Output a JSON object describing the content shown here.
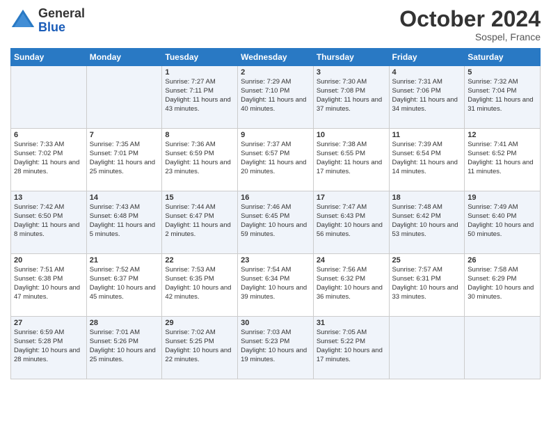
{
  "header": {
    "logo_general": "General",
    "logo_blue": "Blue",
    "month_title": "October 2024",
    "location": "Sospel, France"
  },
  "weekdays": [
    "Sunday",
    "Monday",
    "Tuesday",
    "Wednesday",
    "Thursday",
    "Friday",
    "Saturday"
  ],
  "weeks": [
    [
      {
        "day": "",
        "info": ""
      },
      {
        "day": "",
        "info": ""
      },
      {
        "day": "1",
        "info": "Sunrise: 7:27 AM\nSunset: 7:11 PM\nDaylight: 11 hours and 43 minutes."
      },
      {
        "day": "2",
        "info": "Sunrise: 7:29 AM\nSunset: 7:10 PM\nDaylight: 11 hours and 40 minutes."
      },
      {
        "day": "3",
        "info": "Sunrise: 7:30 AM\nSunset: 7:08 PM\nDaylight: 11 hours and 37 minutes."
      },
      {
        "day": "4",
        "info": "Sunrise: 7:31 AM\nSunset: 7:06 PM\nDaylight: 11 hours and 34 minutes."
      },
      {
        "day": "5",
        "info": "Sunrise: 7:32 AM\nSunset: 7:04 PM\nDaylight: 11 hours and 31 minutes."
      }
    ],
    [
      {
        "day": "6",
        "info": "Sunrise: 7:33 AM\nSunset: 7:02 PM\nDaylight: 11 hours and 28 minutes."
      },
      {
        "day": "7",
        "info": "Sunrise: 7:35 AM\nSunset: 7:01 PM\nDaylight: 11 hours and 25 minutes."
      },
      {
        "day": "8",
        "info": "Sunrise: 7:36 AM\nSunset: 6:59 PM\nDaylight: 11 hours and 23 minutes."
      },
      {
        "day": "9",
        "info": "Sunrise: 7:37 AM\nSunset: 6:57 PM\nDaylight: 11 hours and 20 minutes."
      },
      {
        "day": "10",
        "info": "Sunrise: 7:38 AM\nSunset: 6:55 PM\nDaylight: 11 hours and 17 minutes."
      },
      {
        "day": "11",
        "info": "Sunrise: 7:39 AM\nSunset: 6:54 PM\nDaylight: 11 hours and 14 minutes."
      },
      {
        "day": "12",
        "info": "Sunrise: 7:41 AM\nSunset: 6:52 PM\nDaylight: 11 hours and 11 minutes."
      }
    ],
    [
      {
        "day": "13",
        "info": "Sunrise: 7:42 AM\nSunset: 6:50 PM\nDaylight: 11 hours and 8 minutes."
      },
      {
        "day": "14",
        "info": "Sunrise: 7:43 AM\nSunset: 6:48 PM\nDaylight: 11 hours and 5 minutes."
      },
      {
        "day": "15",
        "info": "Sunrise: 7:44 AM\nSunset: 6:47 PM\nDaylight: 11 hours and 2 minutes."
      },
      {
        "day": "16",
        "info": "Sunrise: 7:46 AM\nSunset: 6:45 PM\nDaylight: 10 hours and 59 minutes."
      },
      {
        "day": "17",
        "info": "Sunrise: 7:47 AM\nSunset: 6:43 PM\nDaylight: 10 hours and 56 minutes."
      },
      {
        "day": "18",
        "info": "Sunrise: 7:48 AM\nSunset: 6:42 PM\nDaylight: 10 hours and 53 minutes."
      },
      {
        "day": "19",
        "info": "Sunrise: 7:49 AM\nSunset: 6:40 PM\nDaylight: 10 hours and 50 minutes."
      }
    ],
    [
      {
        "day": "20",
        "info": "Sunrise: 7:51 AM\nSunset: 6:38 PM\nDaylight: 10 hours and 47 minutes."
      },
      {
        "day": "21",
        "info": "Sunrise: 7:52 AM\nSunset: 6:37 PM\nDaylight: 10 hours and 45 minutes."
      },
      {
        "day": "22",
        "info": "Sunrise: 7:53 AM\nSunset: 6:35 PM\nDaylight: 10 hours and 42 minutes."
      },
      {
        "day": "23",
        "info": "Sunrise: 7:54 AM\nSunset: 6:34 PM\nDaylight: 10 hours and 39 minutes."
      },
      {
        "day": "24",
        "info": "Sunrise: 7:56 AM\nSunset: 6:32 PM\nDaylight: 10 hours and 36 minutes."
      },
      {
        "day": "25",
        "info": "Sunrise: 7:57 AM\nSunset: 6:31 PM\nDaylight: 10 hours and 33 minutes."
      },
      {
        "day": "26",
        "info": "Sunrise: 7:58 AM\nSunset: 6:29 PM\nDaylight: 10 hours and 30 minutes."
      }
    ],
    [
      {
        "day": "27",
        "info": "Sunrise: 6:59 AM\nSunset: 5:28 PM\nDaylight: 10 hours and 28 minutes."
      },
      {
        "day": "28",
        "info": "Sunrise: 7:01 AM\nSunset: 5:26 PM\nDaylight: 10 hours and 25 minutes."
      },
      {
        "day": "29",
        "info": "Sunrise: 7:02 AM\nSunset: 5:25 PM\nDaylight: 10 hours and 22 minutes."
      },
      {
        "day": "30",
        "info": "Sunrise: 7:03 AM\nSunset: 5:23 PM\nDaylight: 10 hours and 19 minutes."
      },
      {
        "day": "31",
        "info": "Sunrise: 7:05 AM\nSunset: 5:22 PM\nDaylight: 10 hours and 17 minutes."
      },
      {
        "day": "",
        "info": ""
      },
      {
        "day": "",
        "info": ""
      }
    ]
  ]
}
